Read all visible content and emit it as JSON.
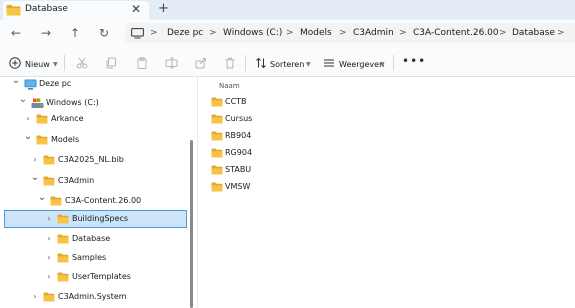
{
  "tab": {
    "title": "Database",
    "close": "✕",
    "new_tab": "+"
  },
  "nav": {
    "back": "←",
    "forward": "→",
    "up": "↑",
    "refresh": "↻",
    "breadcrumbs": [
      "Deze pc",
      "Windows  (C:)",
      "Models",
      "C3Admin",
      "C3A-Content.26.00",
      "Database"
    ],
    "separator": ">"
  },
  "toolbar": {
    "new_label": "Nieuw",
    "sort_label": "Sorteren",
    "view_label": "Weergeven",
    "more": "•••",
    "icons": [
      "cut-icon",
      "copy-icon",
      "paste-icon",
      "rename-icon",
      "share-icon",
      "delete-icon"
    ]
  },
  "tree": [
    {
      "label": "Deze pc",
      "chevron": "v",
      "icon": "pc"
    },
    {
      "label": "Windows  (C:)",
      "chevron": "v",
      "icon": "drive"
    },
    {
      "label": "Arkance",
      "chevron": ">",
      "icon": "folder"
    },
    {
      "label": "Models",
      "chevron": "v",
      "icon": "folder"
    },
    {
      "label": "C3A2025_NL.bib",
      "chevron": ">",
      "icon": "folder"
    },
    {
      "label": "C3Admin",
      "chevron": "v",
      "icon": "folder"
    },
    {
      "label": "C3A-Content.26.00",
      "chevron": "v",
      "icon": "folder"
    },
    {
      "label": "BuildingSpecs",
      "chevron": ">",
      "icon": "folder",
      "selected": true
    },
    {
      "label": "Database",
      "chevron": ">",
      "icon": "folder"
    },
    {
      "label": "Samples",
      "chevron": ">",
      "icon": "folder"
    },
    {
      "label": "UserTemplates",
      "chevron": ">",
      "icon": "folder"
    },
    {
      "label": "C3Admin.System",
      "chevron": ">",
      "icon": "folder"
    }
  ],
  "content": {
    "column_header": "Naam",
    "items": [
      "CCTB",
      "Cursus",
      "RB904",
      "RG904",
      "STABU",
      "VMSW"
    ]
  },
  "colors": {
    "folder": "#f6c343",
    "folder_dark": "#e0a92a",
    "accent": "#0067c0",
    "selection": "#cce4f7"
  }
}
